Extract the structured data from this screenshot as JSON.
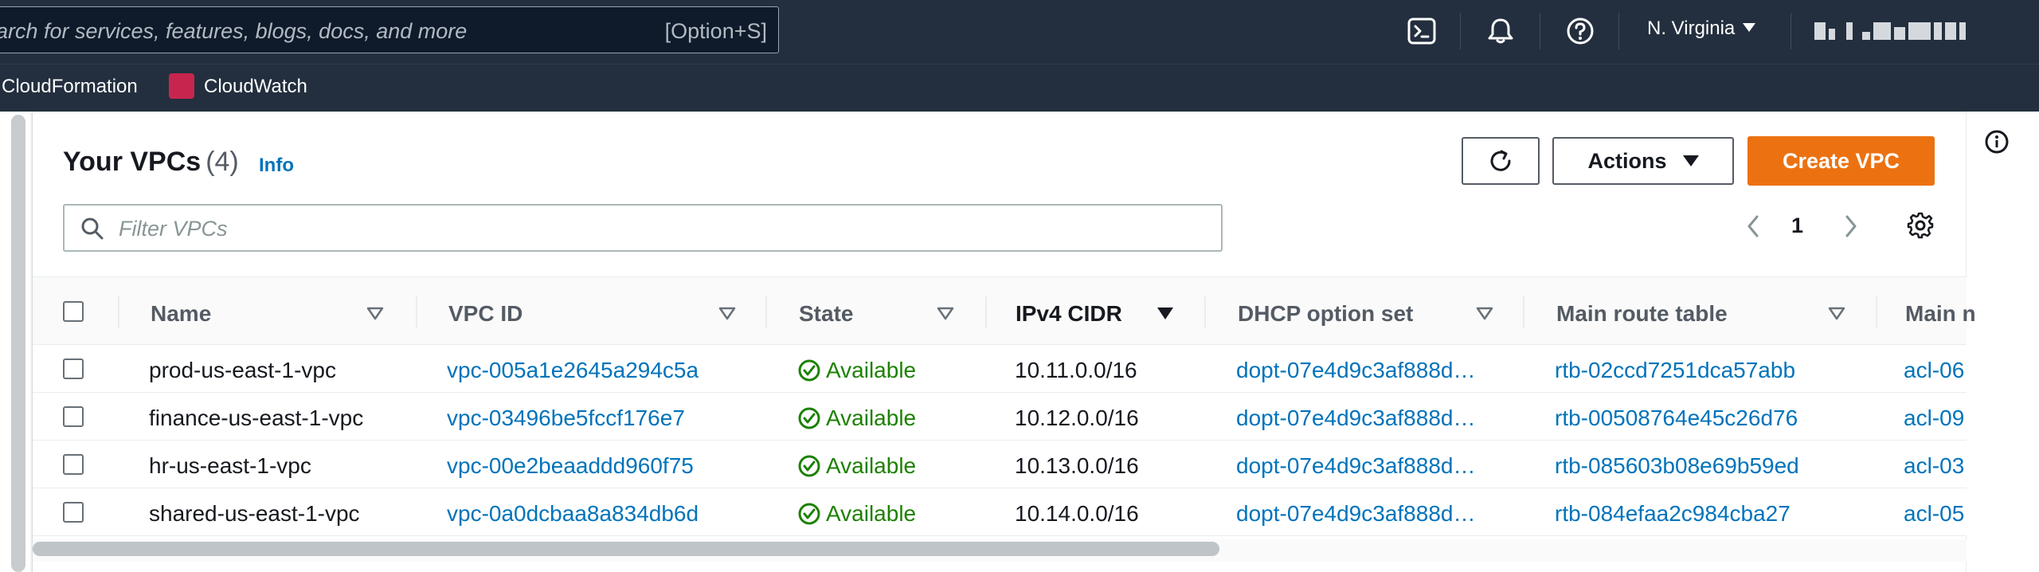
{
  "topnav": {
    "search_placeholder": "arch for services, features, blogs, docs, and more",
    "search_shortcut": "[Option+S]",
    "region": "N. Virginia"
  },
  "favorites": [
    {
      "label": "CloudFormation"
    },
    {
      "label": "CloudWatch"
    }
  ],
  "header": {
    "title": "Your VPCs",
    "count": "(4)",
    "info_label": "Info"
  },
  "toolbar": {
    "actions_label": "Actions",
    "create_label": "Create VPC"
  },
  "filter": {
    "placeholder": "Filter VPCs"
  },
  "pagination": {
    "current_page": "1"
  },
  "table": {
    "columns": [
      "Name",
      "VPC ID",
      "State",
      "IPv4 CIDR",
      "DHCP option set",
      "Main route table",
      "Main n"
    ],
    "sorted_column": "IPv4 CIDR",
    "rows": [
      {
        "name": "prod-us-east-1-vpc",
        "vpc_id": "vpc-005a1e2645a294c5a",
        "state": "Available",
        "cidr": "10.11.0.0/16",
        "dhcp": "dopt-07e4d9c3af888d…",
        "route_table": "rtb-02ccd7251dca57abb",
        "nacl": "acl-06"
      },
      {
        "name": "finance-us-east-1-vpc",
        "vpc_id": "vpc-03496be5fccf176e7",
        "state": "Available",
        "cidr": "10.12.0.0/16",
        "dhcp": "dopt-07e4d9c3af888d…",
        "route_table": "rtb-00508764e45c26d76",
        "nacl": "acl-09"
      },
      {
        "name": "hr-us-east-1-vpc",
        "vpc_id": "vpc-00e2beaaddd960f75",
        "state": "Available",
        "cidr": "10.13.0.0/16",
        "dhcp": "dopt-07e4d9c3af888d…",
        "route_table": "rtb-085603b08e69b59ed",
        "nacl": "acl-03"
      },
      {
        "name": "shared-us-east-1-vpc",
        "vpc_id": "vpc-0a0dcbaa8a834db6d",
        "state": "Available",
        "cidr": "10.14.0.0/16",
        "dhcp": "dopt-07e4d9c3af888d…",
        "route_table": "rtb-084efaa2c984cba27",
        "nacl": "acl-05"
      }
    ]
  },
  "colors": {
    "nav_bg": "#232f3e",
    "primary": "#ec7211",
    "link": "#0073bb",
    "success": "#1d8102"
  },
  "icons": {
    "cloudshell": "cloudshell-icon",
    "notifications": "bell-icon",
    "help": "help-icon",
    "refresh": "refresh-icon",
    "search": "search-icon",
    "settings": "gear-icon",
    "info_panel": "info-icon"
  }
}
